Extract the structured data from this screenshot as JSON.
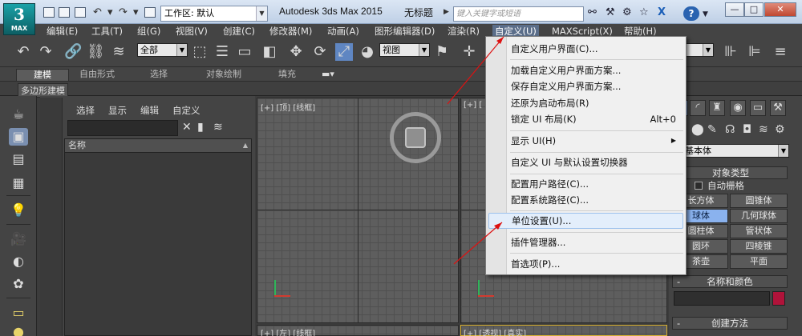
{
  "window": {
    "app_title": "Autodesk 3ds Max  2015",
    "doc_title": "无标题",
    "logo_text": "MAX",
    "workspace_label": "工作区: 默认",
    "search_placeholder": "键入关键字或短语",
    "minimize": "—",
    "maximize": "□",
    "close": "✕",
    "help": "?"
  },
  "menubar": [
    "编辑(E)",
    "工具(T)",
    "组(G)",
    "视图(V)",
    "创建(C)",
    "修改器(M)",
    "动画(A)",
    "图形编辑器(D)",
    "渲染(R)",
    "自定义(U)",
    "MAXScript(X)",
    "帮助(H)"
  ],
  "toolbar": {
    "selection_filter": "全部",
    "reference_coord": "视图"
  },
  "ribbon": {
    "tabs": [
      "建模",
      "自由形式",
      "选择",
      "对象绘制",
      "填充"
    ],
    "subtab": "多边形建模"
  },
  "explorer": {
    "menus": [
      "选择",
      "显示",
      "编辑",
      "自定义"
    ],
    "column_header": "名称"
  },
  "viewports": {
    "top": "[+] [顶] [线框]",
    "front": "[+] [",
    "left_bottom": "[+] [左] [线框]",
    "persp": "[+] [透视] [真实]"
  },
  "dropdown": {
    "items": [
      {
        "label": "自定义用户界面(C)...",
        "shortcut": ""
      },
      {
        "label": "加载自定义用户界面方案...",
        "shortcut": ""
      },
      {
        "label": "保存自定义用户界面方案...",
        "shortcut": ""
      },
      {
        "label": "还原为启动布局(R)",
        "shortcut": ""
      },
      {
        "label": "锁定 UI 布局(K)",
        "shortcut": "Alt+0"
      },
      {
        "label": "显示 UI(H)",
        "shortcut": "▶"
      },
      {
        "label": "自定义 UI 与默认设置切换器",
        "shortcut": ""
      },
      {
        "label": "配置用户路径(C)...",
        "shortcut": ""
      },
      {
        "label": "配置系统路径(C)...",
        "shortcut": ""
      },
      {
        "label": "单位设置(U)...",
        "shortcut": ""
      },
      {
        "label": "插件管理器...",
        "shortcut": ""
      },
      {
        "label": "首选项(P)...",
        "shortcut": ""
      }
    ]
  },
  "command_panel": {
    "category": "准基本体",
    "object_type_title": "对象类型",
    "autogrid": "自动栅格",
    "buttons": [
      "长方体",
      "圆锥体",
      "球体",
      "几何球体",
      "圆柱体",
      "管状体",
      "圆环",
      "四棱锥",
      "茶壶",
      "平面"
    ],
    "active_button": "球体",
    "name_color_title": "名称和颜色",
    "creation_method_title": "创建方法",
    "swatch_color": "#b0133a"
  },
  "colors": {
    "highlight": "#e3eefb",
    "annotation_arrow": "#dd1111"
  }
}
